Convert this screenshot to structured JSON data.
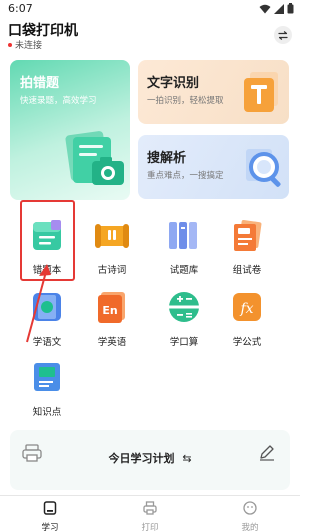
{
  "status_bar": {
    "time": "6:07"
  },
  "header": {
    "title": "口袋打印机",
    "connection": "未连接"
  },
  "cards": {
    "wrong_questions": {
      "title": "拍错题",
      "subtitle": "快速录题，高效学习"
    },
    "ocr": {
      "title": "文字识别",
      "subtitle": "一拍识别，轻松提取"
    },
    "search": {
      "title": "搜解析",
      "subtitle": "重点难点，一搜搞定"
    }
  },
  "tools": [
    {
      "label": "错题本",
      "icon": "notebook-icon"
    },
    {
      "label": "古诗词",
      "icon": "scroll-icon"
    },
    {
      "label": "试题库",
      "icon": "books-icon"
    },
    {
      "label": "组试卷",
      "icon": "exam-paper-icon"
    },
    {
      "label": "学语文",
      "icon": "chinese-icon"
    },
    {
      "label": "学英语",
      "icon": "english-icon"
    },
    {
      "label": "学口算",
      "icon": "calculator-icon"
    },
    {
      "label": "学公式",
      "icon": "formula-icon"
    },
    {
      "label": "知识点",
      "icon": "knowledge-icon"
    }
  ],
  "plan": {
    "title": "今日学习计划"
  },
  "bottom_nav": [
    {
      "label": "学习",
      "active": true
    },
    {
      "label": "打印",
      "active": false
    },
    {
      "label": "我的",
      "active": false
    }
  ],
  "colors": {
    "accent": "#35c7a0",
    "highlight": "#e53935"
  }
}
